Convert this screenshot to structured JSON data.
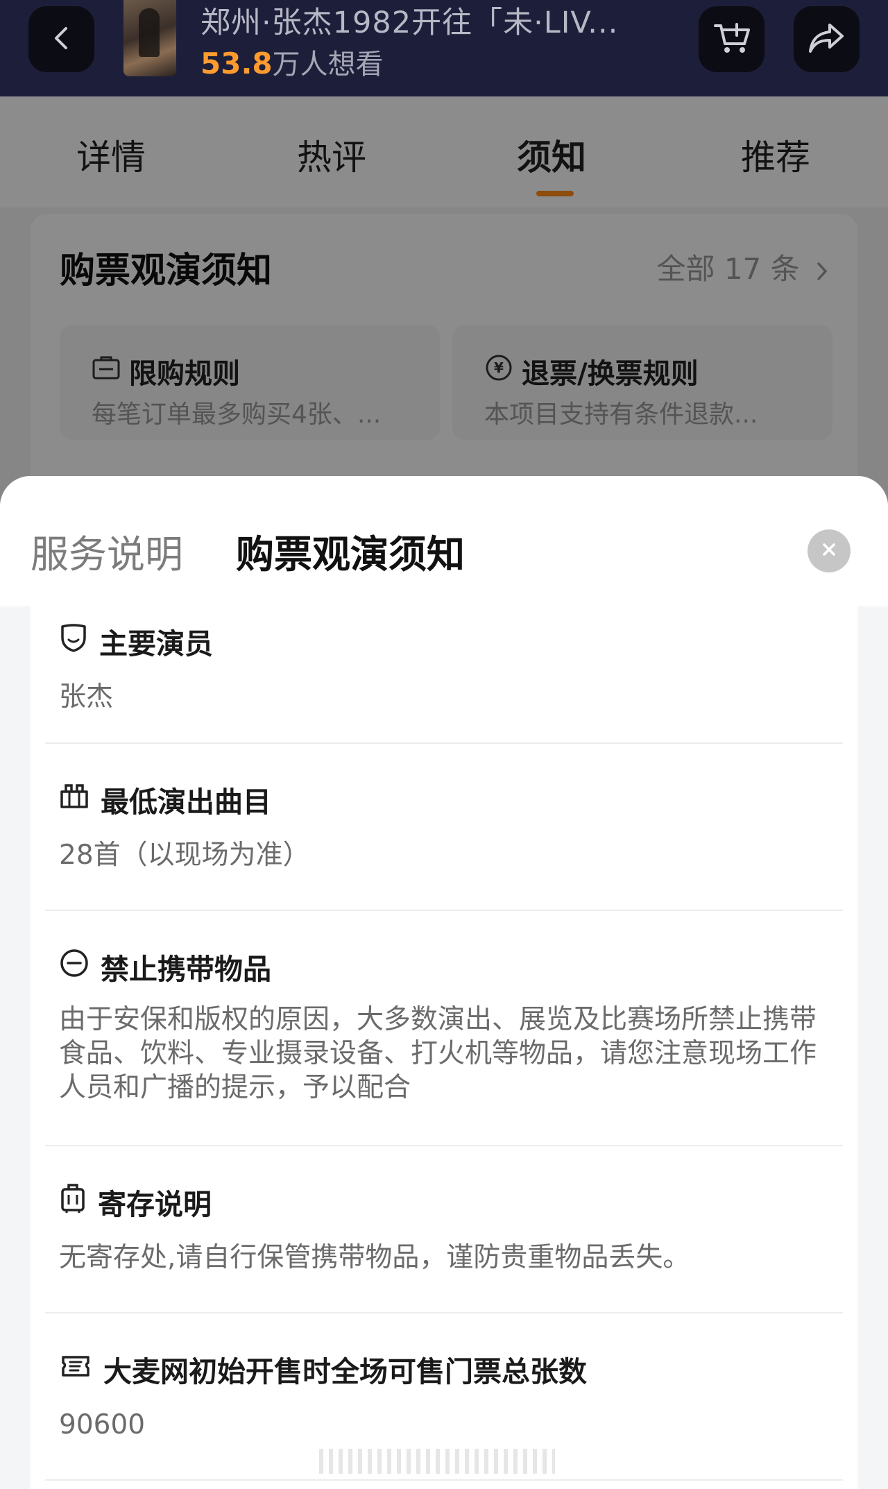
{
  "topbar": {
    "title": "郑州·张杰1982开往「未·LIV...",
    "want_count": "53.8",
    "want_suffix": "万人想看"
  },
  "tabs": [
    {
      "label": "详情"
    },
    {
      "label": "热评"
    },
    {
      "label": "须知",
      "active": true
    },
    {
      "label": "推荐"
    }
  ],
  "notice_card": {
    "title": "购票观演须知",
    "all_link": "全部 17 条",
    "boxes": [
      {
        "title": "限购规则",
        "sub": "每笔订单最多购买4张、...",
        "icon": "ticket-icon"
      },
      {
        "title": "退票/换票规则",
        "sub": "本项目支持有条件退款...",
        "icon": "refund-icon"
      }
    ]
  },
  "sheet": {
    "tab_inactive": "服务说明",
    "tab_active": "购票观演须知",
    "items": [
      {
        "title": "主要演员",
        "body": "张杰",
        "icon": "mask-icon"
      },
      {
        "title": "最低演出曲目",
        "body": "28首（以现场为准）",
        "icon": "music-icon"
      },
      {
        "title": "禁止携带物品",
        "body": "由于安保和版权的原因，大多数演出、展览及比赛场所禁止携带食品、饮料、专业摄录设备、打火机等物品，请您注意现场工作人员和广播的提示，予以配合",
        "icon": "forbidden-icon"
      },
      {
        "title": "寄存说明",
        "body": "无寄存处,请自行保管携带物品，谨防贵重物品丢失。",
        "icon": "luggage-icon"
      },
      {
        "title": "大麦网初始开售时全场可售门票总张数",
        "body": "90600",
        "icon": "ticket-stack-icon"
      }
    ]
  },
  "colors": {
    "topbar_bg": "#1d1f3a",
    "accent_orange": "#ff8c1a",
    "want_count": "#ff9b2e"
  }
}
